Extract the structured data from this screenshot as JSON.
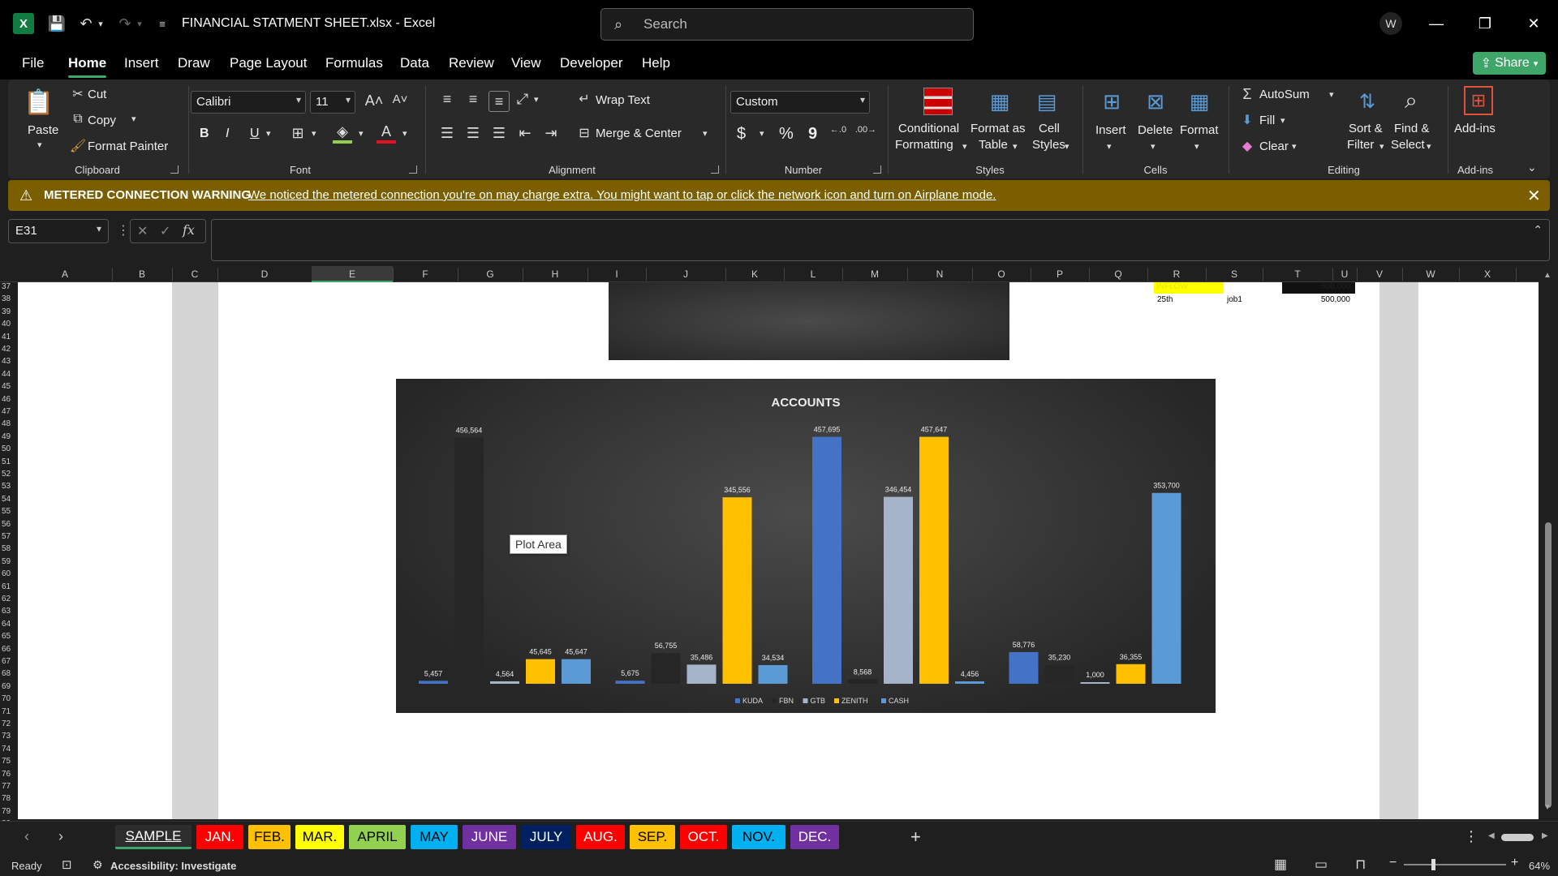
{
  "titlebar": {
    "doc_title": "FINANCIAL STATMENT SHEET.xlsx  -  Excel",
    "search_placeholder": "Search"
  },
  "menu": [
    "File",
    "Home",
    "Insert",
    "Draw",
    "Page Layout",
    "Formulas",
    "Data",
    "Review",
    "View",
    "Developer",
    "Help"
  ],
  "share_label": "Share",
  "ribbon": {
    "clipboard": {
      "paste": "Paste",
      "cut": "Cut",
      "copy": "Copy",
      "format_painter": "Format Painter",
      "label": "Clipboard"
    },
    "font": {
      "name": "Calibri",
      "size": "11",
      "bold": "B",
      "italic": "I",
      "underline": "U",
      "label": "Font"
    },
    "alignment": {
      "wrap_text": "Wrap Text",
      "merge_center": "Merge & Center",
      "label": "Alignment"
    },
    "number": {
      "format": "Custom",
      "currency": "$",
      "percent": "%",
      "comma": "9",
      "label": "Number"
    },
    "styles": {
      "conditional_1": "Conditional",
      "conditional_2": "Formatting",
      "format_table_1": "Format as",
      "format_table_2": "Table",
      "cell_styles_1": "Cell",
      "cell_styles_2": "Styles",
      "label": "Styles"
    },
    "cells": {
      "insert": "Insert",
      "delete": "Delete",
      "format": "Format",
      "label": "Cells"
    },
    "editing": {
      "autosum": "AutoSum",
      "fill": "Fill",
      "clear": "Clear",
      "sort_1": "Sort &",
      "sort_2": "Filter",
      "find_1": "Find &",
      "find_2": "Select",
      "label": "Editing"
    },
    "addins": {
      "addins": "Add-ins",
      "label": "Add-ins"
    }
  },
  "warning": {
    "title": "METERED CONNECTION WARNING",
    "message": "We noticed the metered connection you're on may charge extra. You might want to tap or click the network icon and turn on Airplane mode."
  },
  "namebox": "E31",
  "columns": [
    "A",
    "B",
    "C",
    "D",
    "E",
    "F",
    "G",
    "H",
    "I",
    "J",
    "K",
    "L",
    "M",
    "N",
    "O",
    "P",
    "Q",
    "R",
    "S",
    "T",
    "U",
    "V",
    "W",
    "X"
  ],
  "rows": [
    "37",
    "38",
    "39",
    "40",
    "41",
    "42",
    "43",
    "44",
    "45",
    "46",
    "47",
    "48",
    "49",
    "50",
    "51",
    "52",
    "53",
    "54",
    "55",
    "56",
    "57",
    "58",
    "59",
    "60",
    "61",
    "62",
    "63",
    "64",
    "65",
    "66",
    "67",
    "68",
    "69",
    "70",
    "71",
    "72",
    "73",
    "74",
    "75",
    "76",
    "77",
    "78",
    "79",
    "80"
  ],
  "cells": {
    "inflow": "INFLOW",
    "inflow_value": "500,000",
    "date": "25th",
    "job": "job1",
    "amount": "500,000"
  },
  "tooltip": "Plot Area",
  "chart_data": {
    "type": "bar",
    "title": "ACCOUNTS",
    "series_names": [
      "KUDA",
      "FBN",
      "GTB",
      "ZENITH",
      "CASH"
    ],
    "colors": {
      "KUDA": "#4472c4",
      "FBN": "#262626",
      "GTB": "#a5b4c9",
      "ZENITH": "#ffc000",
      "CASH": "#5b9bd5"
    },
    "groups": [
      {
        "values": [
          5457,
          456564,
          4564,
          45645,
          45647
        ]
      },
      {
        "values": [
          5675,
          56755,
          35486,
          345556,
          34534
        ]
      },
      {
        "values": [
          457695,
          8568,
          346454,
          457647,
          4456
        ]
      },
      {
        "values": [
          58776,
          35230,
          1000,
          36355,
          353700
        ]
      }
    ],
    "labels": [
      [
        "5,457",
        "456,564",
        "4,564",
        "45,645",
        "45,647"
      ],
      [
        "5,675",
        "56,755",
        "35,486",
        "345,556",
        "34,534"
      ],
      [
        "457,695",
        "8,568",
        "346,454",
        "457,647",
        "4,456"
      ],
      [
        "58,776",
        "35,230",
        "1,000",
        "36,355",
        "353,700"
      ]
    ],
    "ylim": [
      0,
      460000
    ],
    "legend": "bottom"
  },
  "sheet_tabs": [
    {
      "label": "SAMPLE",
      "bg": "#1f1f1f",
      "fg": "#ffffff"
    },
    {
      "label": "JAN.",
      "bg": "#ff0000",
      "fg": "#ffffff"
    },
    {
      "label": "FEB.",
      "bg": "#ffc000",
      "fg": "#000000"
    },
    {
      "label": "MAR.",
      "bg": "#ffff00",
      "fg": "#000000"
    },
    {
      "label": "APRIL",
      "bg": "#92d050",
      "fg": "#000000"
    },
    {
      "label": "MAY",
      "bg": "#00b0f0",
      "fg": "#000000"
    },
    {
      "label": "JUNE",
      "bg": "#7030a0",
      "fg": "#ffffff"
    },
    {
      "label": "JULY",
      "bg": "#002060",
      "fg": "#ffffff"
    },
    {
      "label": "AUG.",
      "bg": "#ff0000",
      "fg": "#ffffff"
    },
    {
      "label": "SEP.",
      "bg": "#ffc000",
      "fg": "#000000"
    },
    {
      "label": "OCT.",
      "bg": "#ff0000",
      "fg": "#ffffff"
    },
    {
      "label": "NOV.",
      "bg": "#00b0f0",
      "fg": "#000000"
    },
    {
      "label": "DEC.",
      "bg": "#7030a0",
      "fg": "#ffffff"
    }
  ],
  "status": {
    "ready": "Ready",
    "accessibility": "Accessibility: Investigate",
    "zoom": "64%"
  }
}
